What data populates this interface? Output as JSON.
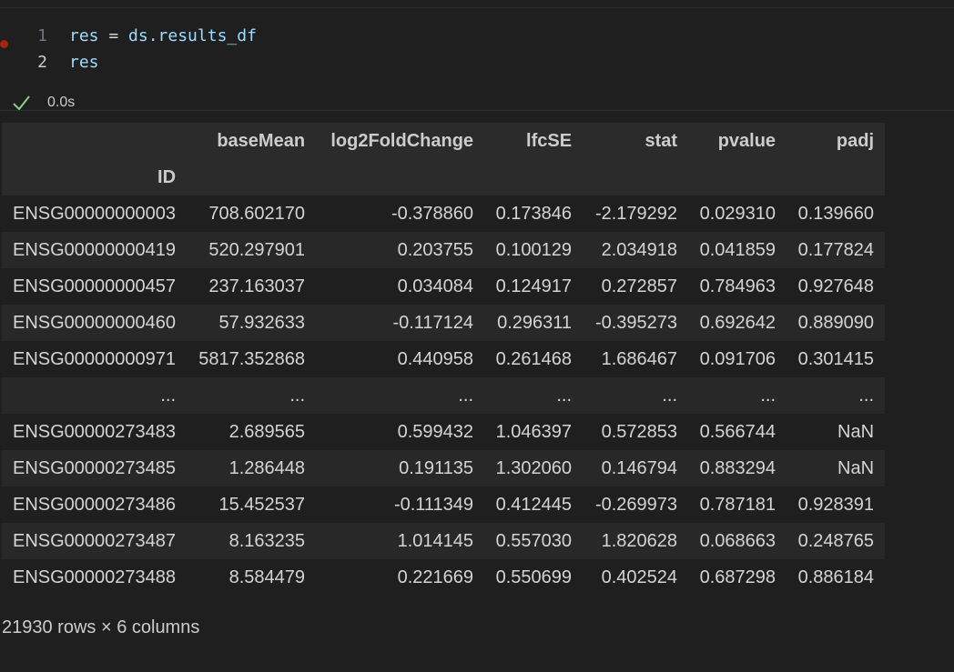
{
  "code_cell": {
    "lines": [
      {
        "number": "1",
        "tokens": {
          "a": "res",
          "b": " = ",
          "c": "ds.results_df"
        }
      },
      {
        "number": "2",
        "tokens": {
          "a": "res"
        }
      }
    ],
    "status": {
      "icon": "checkmark-icon",
      "time": "0.0s"
    }
  },
  "table": {
    "columns": [
      "baseMean",
      "log2FoldChange",
      "lfcSE",
      "stat",
      "pvalue",
      "padj"
    ],
    "index_name": "ID",
    "rows": [
      [
        "ENSG00000000003",
        "708.602170",
        "-0.378860",
        "0.173846",
        "-2.179292",
        "0.029310",
        "0.139660"
      ],
      [
        "ENSG00000000419",
        "520.297901",
        "0.203755",
        "0.100129",
        "2.034918",
        "0.041859",
        "0.177824"
      ],
      [
        "ENSG00000000457",
        "237.163037",
        "0.034084",
        "0.124917",
        "0.272857",
        "0.784963",
        "0.927648"
      ],
      [
        "ENSG00000000460",
        "57.932633",
        "-0.117124",
        "0.296311",
        "-0.395273",
        "0.692642",
        "0.889090"
      ],
      [
        "ENSG00000000971",
        "5817.352868",
        "0.440958",
        "0.261468",
        "1.686467",
        "0.091706",
        "0.301415"
      ],
      [
        "...",
        "...",
        "...",
        "...",
        "...",
        "...",
        "..."
      ],
      [
        "ENSG00000273483",
        "2.689565",
        "0.599432",
        "1.046397",
        "0.572853",
        "0.566744",
        "NaN"
      ],
      [
        "ENSG00000273485",
        "1.286448",
        "0.191135",
        "1.302060",
        "0.146794",
        "0.883294",
        "NaN"
      ],
      [
        "ENSG00000273486",
        "15.452537",
        "-0.111349",
        "0.412445",
        "-0.269973",
        "0.787181",
        "0.928391"
      ],
      [
        "ENSG00000273487",
        "8.163235",
        "1.014145",
        "0.557030",
        "1.820628",
        "0.068663",
        "0.248765"
      ],
      [
        "ENSG00000273488",
        "8.584479",
        "0.221669",
        "0.550699",
        "0.402524",
        "0.687298",
        "0.886184"
      ]
    ]
  },
  "footer": {
    "shape": "21930 rows × 6 columns"
  },
  "colors": {
    "breakpoint": "#a1260d",
    "check": "#89d185",
    "background": "#1f1f1f"
  }
}
